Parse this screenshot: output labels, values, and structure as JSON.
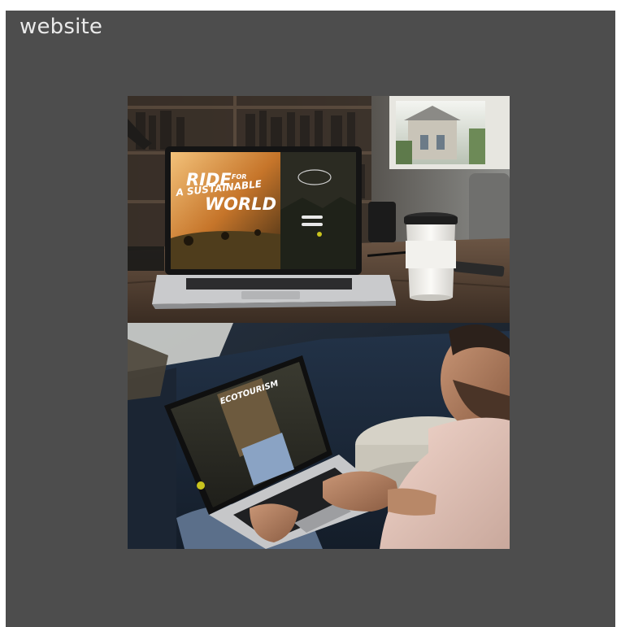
{
  "section": {
    "title": "website"
  },
  "photo_desk": {
    "icon": "laptop-desk-photo",
    "screen_headline_line1": "RIDE",
    "screen_headline_for": "FOR",
    "screen_headline_line2": "A SUSTAINABLE",
    "screen_headline_line3": "WORLD"
  },
  "photo_lap": {
    "icon": "laptop-lap-photo",
    "screen_headline": "ECOTOURISM"
  },
  "colors": {
    "panel_bg": "#4d4d4d",
    "title_text": "#eaeaea"
  }
}
